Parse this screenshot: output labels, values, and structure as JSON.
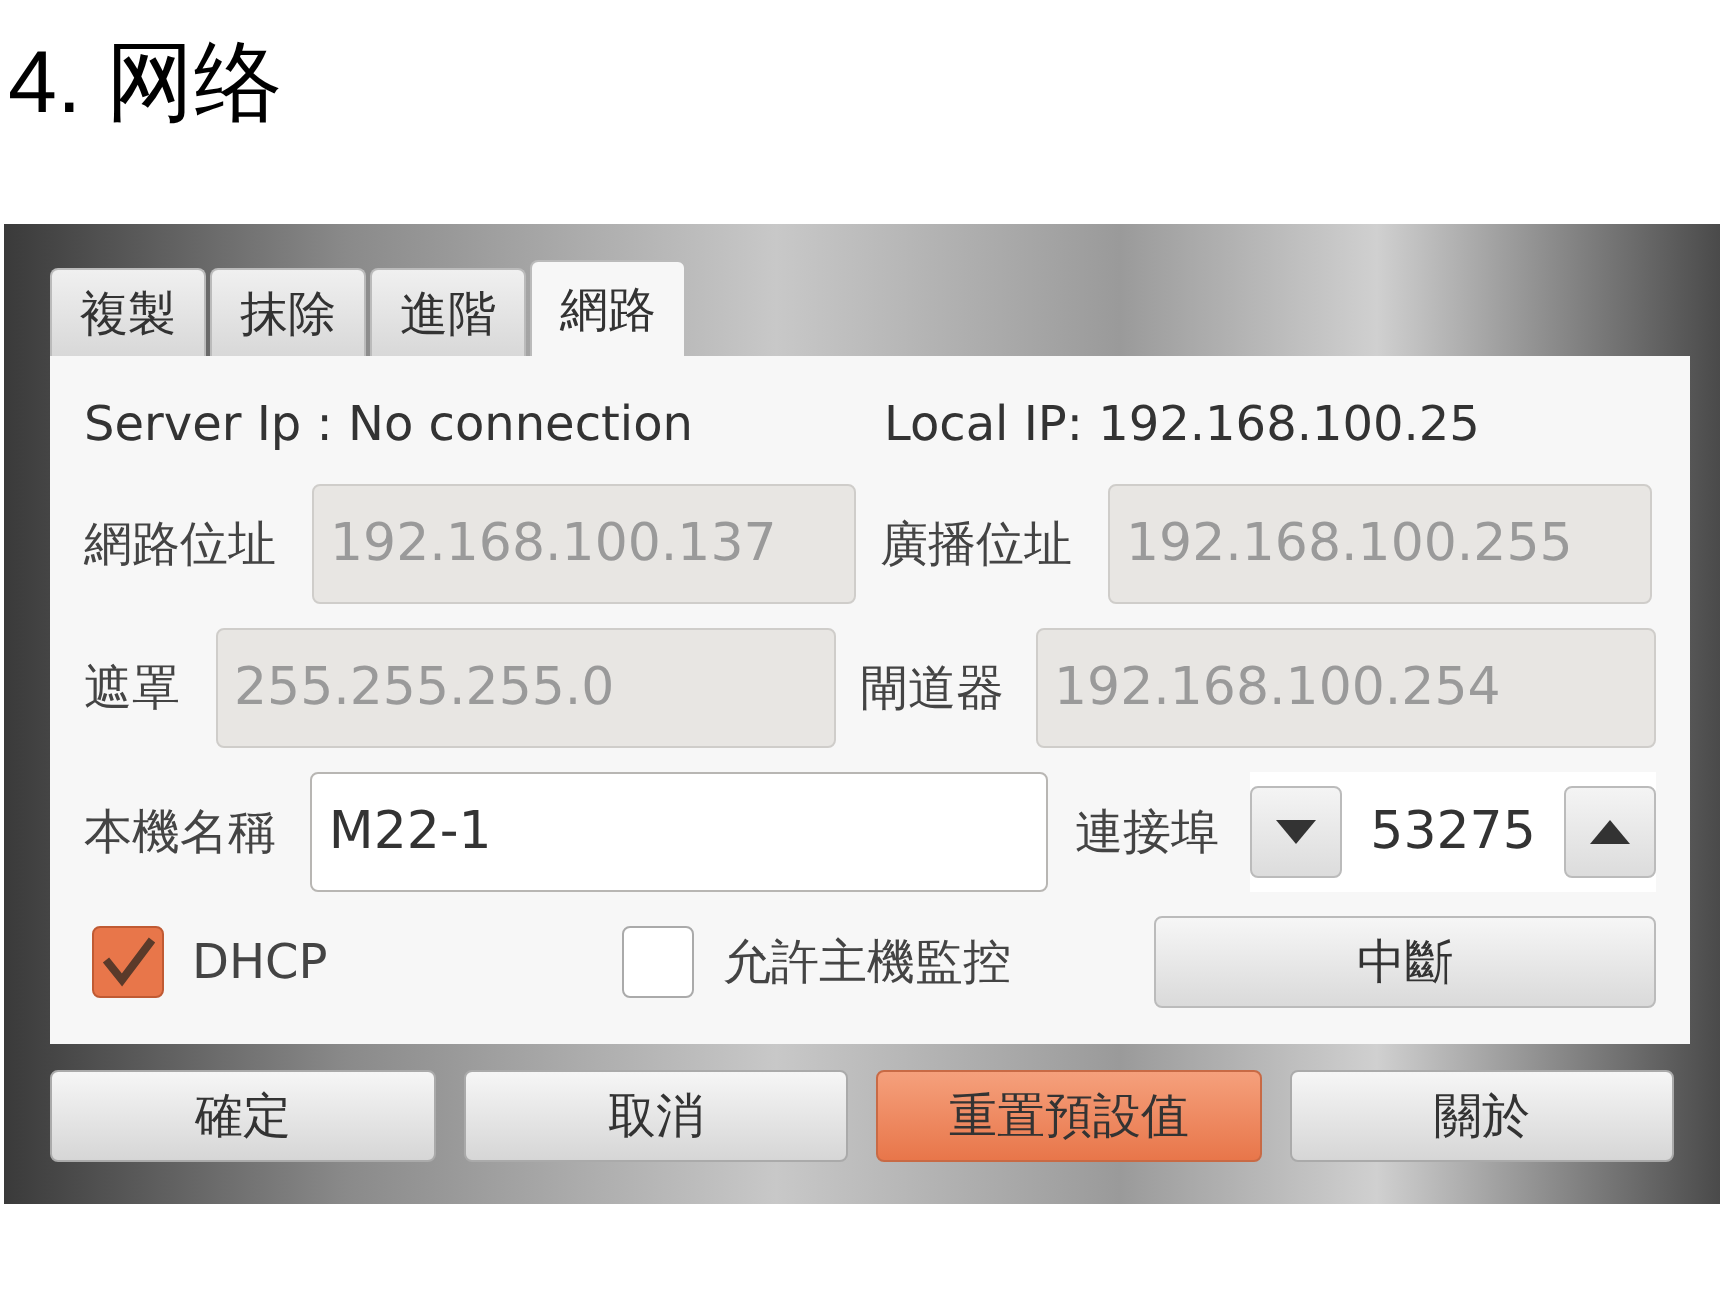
{
  "heading": "4. 网络",
  "tabs": [
    {
      "label": "複製",
      "selected": false
    },
    {
      "label": "抹除",
      "selected": false
    },
    {
      "label": "進階",
      "selected": false
    },
    {
      "label": "網路",
      "selected": true
    }
  ],
  "status": {
    "server": "Server Ip : No connection",
    "local": "Local IP: 192.168.100.25"
  },
  "field_rows": [
    [
      {
        "label": "網路位址",
        "value": "192.168.100.137",
        "disabled": true
      },
      {
        "label": "廣播位址",
        "value": "192.168.100.255",
        "disabled": true
      }
    ],
    [
      {
        "label": "遮罩",
        "value": "255.255.255.0",
        "disabled": true
      },
      {
        "label": "閘道器",
        "value": "192.168.100.254",
        "disabled": true
      }
    ]
  ],
  "hostname": {
    "label": "本機名稱",
    "value": "M22-1",
    "disabled": false
  },
  "port": {
    "label": "連接埠",
    "value": "53275"
  },
  "checkboxes": [
    {
      "label": "DHCP",
      "checked": true
    },
    {
      "label": "允許主機監控",
      "checked": false
    }
  ],
  "disconnect": "中斷",
  "buttons": [
    {
      "label": "確定",
      "kind": "normal"
    },
    {
      "label": "取消",
      "kind": "normal"
    },
    {
      "label": "重置預設值",
      "kind": "primary"
    },
    {
      "label": "關於",
      "kind": "normal"
    }
  ]
}
